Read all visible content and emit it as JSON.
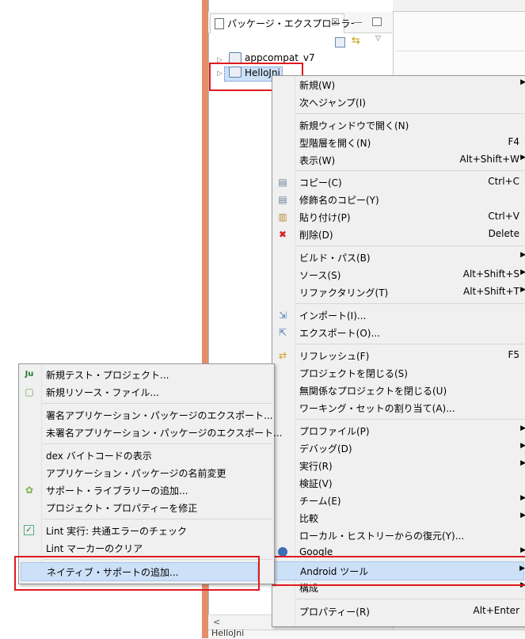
{
  "package_explorer": {
    "title": "パッケージ・エクスプローラー",
    "close_glyph": "☒",
    "tree": [
      {
        "label": "appcompat_v7"
      },
      {
        "label": "HelloJni"
      }
    ],
    "status_text": "HelloJni"
  },
  "context_menu": {
    "items": [
      {
        "label": "新規(W)",
        "submenu": true
      },
      {
        "label": "次へジャンプ(I)"
      },
      {
        "label": "新規ウィンドウで開く(N)"
      },
      {
        "label": "型階層を開く(N)",
        "accel": "F4"
      },
      {
        "label": "表示(W)",
        "accel": "Alt+Shift+W",
        "submenu": true
      },
      {
        "label": "コピー(C)",
        "accel": "Ctrl+C",
        "icon": "copy-icon"
      },
      {
        "label": "修飾名のコピー(Y)",
        "icon": "copy-qualified-icon"
      },
      {
        "label": "貼り付け(P)",
        "accel": "Ctrl+V",
        "icon": "paste-icon"
      },
      {
        "label": "削除(D)",
        "accel": "Delete",
        "icon": "delete-icon"
      },
      {
        "label": "ビルド・パス(B)",
        "submenu": true
      },
      {
        "label": "ソース(S)",
        "accel": "Alt+Shift+S",
        "submenu": true
      },
      {
        "label": "リファクタリング(T)",
        "accel": "Alt+Shift+T",
        "submenu": true
      },
      {
        "label": "インポート(I)...",
        "icon": "import-icon"
      },
      {
        "label": "エクスポート(O)...",
        "icon": "export-icon"
      },
      {
        "label": "リフレッシュ(F)",
        "accel": "F5",
        "icon": "refresh-icon"
      },
      {
        "label": "プロジェクトを閉じる(S)"
      },
      {
        "label": "無関係なプロジェクトを閉じる(U)"
      },
      {
        "label": "ワーキング・セットの割り当て(A)..."
      },
      {
        "label": "プロファイル(P)",
        "submenu": true
      },
      {
        "label": "デバッグ(D)",
        "submenu": true
      },
      {
        "label": "実行(R)",
        "submenu": true
      },
      {
        "label": "検証(V)"
      },
      {
        "label": "チーム(E)",
        "submenu": true
      },
      {
        "label": "比較",
        "submenu": true
      },
      {
        "label": "ローカル・ヒストリーからの復元(Y)..."
      },
      {
        "label": "Google",
        "submenu": true,
        "icon": "google-icon"
      },
      {
        "label": "Android ツール",
        "submenu": true,
        "highlighted": true
      },
      {
        "label": "構成",
        "submenu": true
      },
      {
        "label": "プロパティー(R)",
        "accel": "Alt+Enter"
      }
    ]
  },
  "android_submenu": {
    "items": [
      {
        "label": "新規テスト・プロジェクト...",
        "icon": "junit-icon"
      },
      {
        "label": "新規リソース・ファイル...",
        "icon": "new-resource-icon"
      },
      {
        "label": "署名アプリケーション・パッケージのエクスポート..."
      },
      {
        "label": "未署名アプリケーション・パッケージのエクスポート..."
      },
      {
        "label": "dex バイトコードの表示"
      },
      {
        "label": "アプリケーション・パッケージの名前変更"
      },
      {
        "label": "サポート・ライブラリーの追加...",
        "icon": "android-icon"
      },
      {
        "label": "プロジェクト・プロパティーを修正"
      },
      {
        "label": "Lint 実行: 共通エラーのチェック",
        "icon": "lint-check-icon"
      },
      {
        "label": "Lint マーカーのクリア"
      },
      {
        "label": "ネイティブ・サポートの追加...",
        "highlighted": true
      }
    ]
  },
  "colors": {
    "highlight": "#cce0f7",
    "annotation_red": "#e0191f",
    "menu_bg": "#f0f0f0"
  }
}
